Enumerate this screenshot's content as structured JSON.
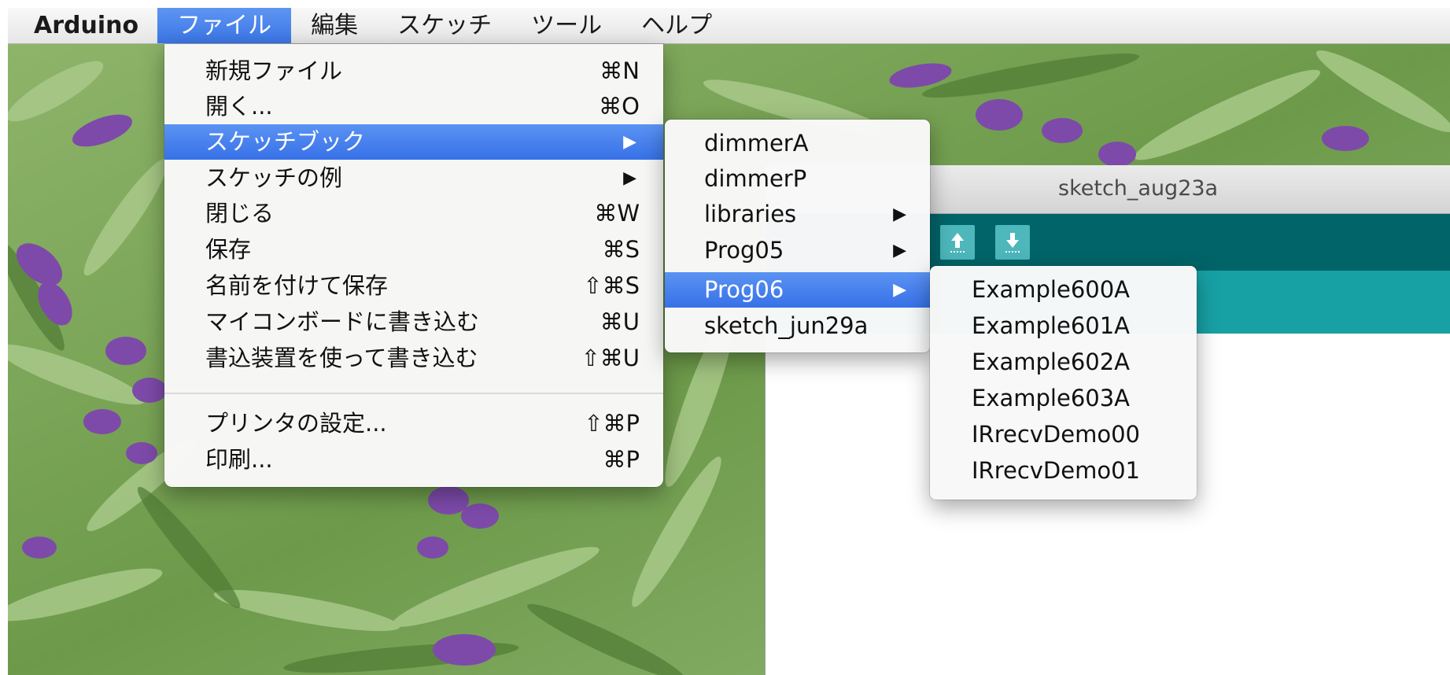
{
  "menubar": {
    "app": "Arduino",
    "items": [
      "ファイル",
      "編集",
      "スケッチ",
      "ツール",
      "ヘルプ"
    ]
  },
  "file_menu": {
    "items": [
      {
        "label": "新規ファイル",
        "shortcut": "⌘N"
      },
      {
        "label": "開く...",
        "shortcut": "⌘O"
      },
      {
        "label": "スケッチブック",
        "arrow": "▶"
      },
      {
        "label": "スケッチの例",
        "arrow": "▶"
      },
      {
        "label": "閉じる",
        "shortcut": "⌘W"
      },
      {
        "label": "保存",
        "shortcut": "⌘S"
      },
      {
        "label": "名前を付けて保存",
        "shortcut": "⇧⌘S"
      },
      {
        "label": "マイコンボードに書き込む",
        "shortcut": "⌘U"
      },
      {
        "label": "書込装置を使って書き込む",
        "shortcut": "⇧⌘U"
      },
      {
        "label": "プリンタの設定...",
        "shortcut": "⇧⌘P"
      },
      {
        "label": "印刷...",
        "shortcut": "⌘P"
      }
    ]
  },
  "sketchbook_menu": {
    "items": [
      {
        "label": "dimmerA"
      },
      {
        "label": "dimmerP"
      },
      {
        "label": "libraries",
        "arrow": "▶"
      },
      {
        "label": "Prog05",
        "arrow": "▶"
      },
      {
        "label": "Prog06",
        "arrow": "▶"
      },
      {
        "label": "sketch_jun29a"
      }
    ]
  },
  "prog06_menu": {
    "items": [
      "Example600A",
      "Example601A",
      "Example602A",
      "Example603A",
      "IRrecvDemo00",
      "IRrecvDemo01"
    ]
  },
  "ide_window": {
    "title": "sketch_aug23a",
    "toolbar_icons": [
      "upload-arrow-icon",
      "save-arrow-icon"
    ]
  },
  "colors": {
    "highlight": "#3b75e6",
    "toolbar": "#006468",
    "tab_bar": "#17a1a5",
    "toolbar_button": "#4db7bb"
  }
}
